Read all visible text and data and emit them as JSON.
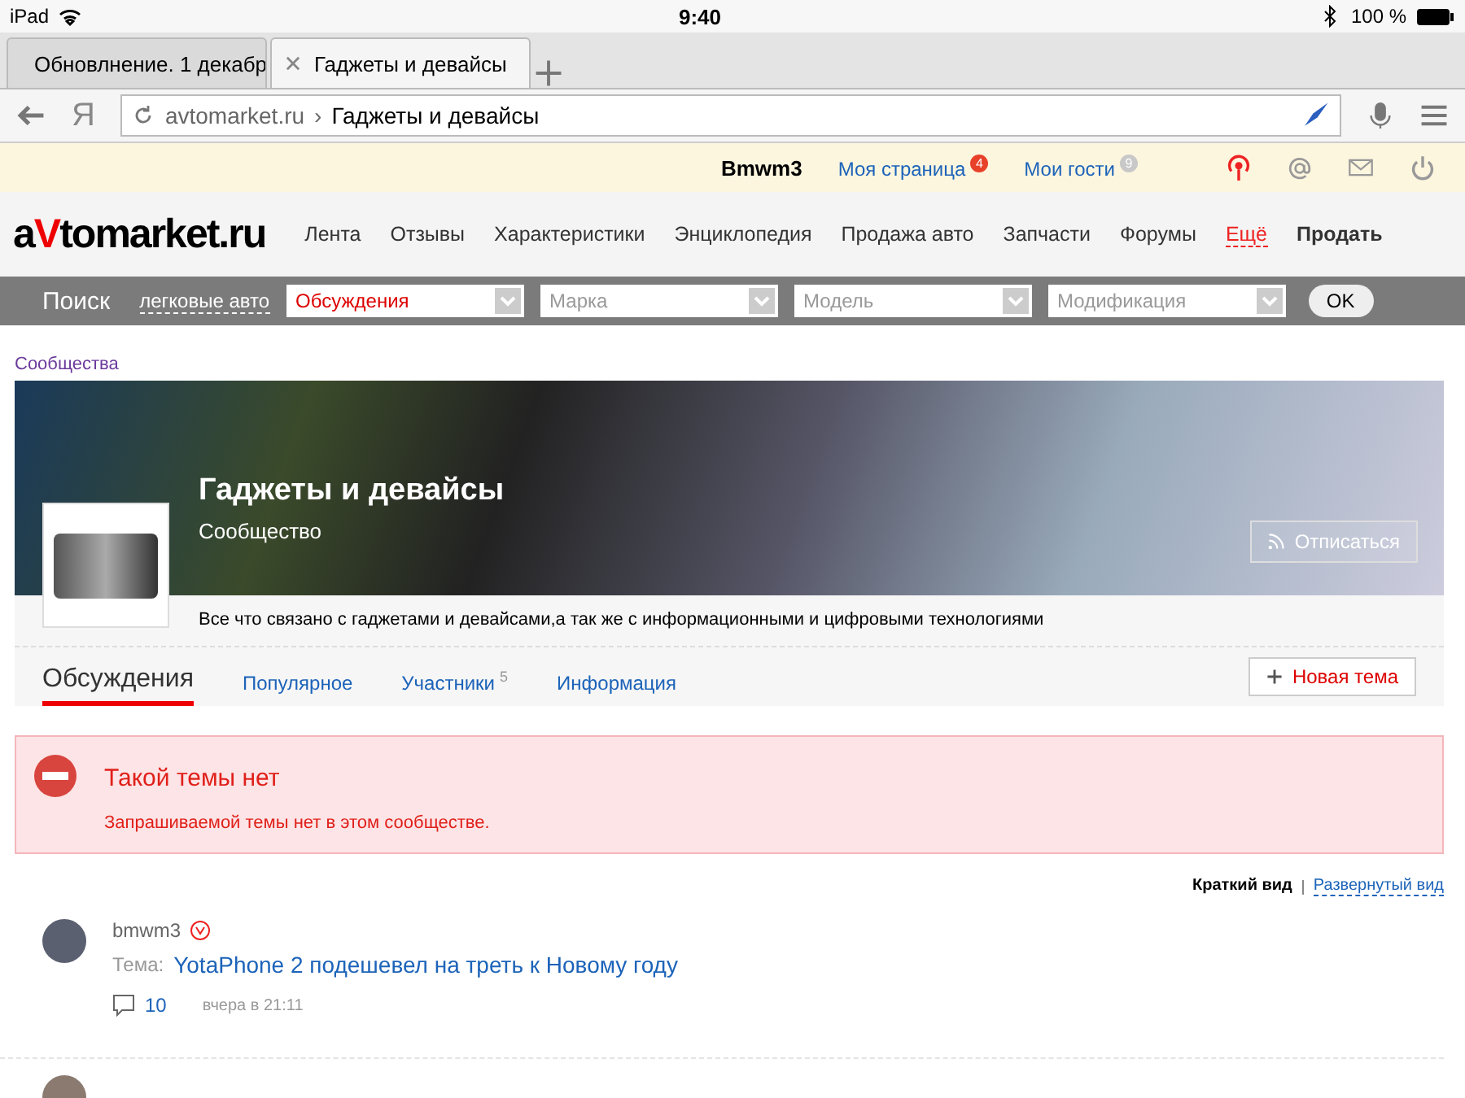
{
  "status_bar": {
    "device": "iPad",
    "time": "9:40",
    "battery": "100 %"
  },
  "browser_tabs": [
    {
      "title": "Обновлнение. 1 декабр",
      "selected": false
    },
    {
      "title": "Гаджеты и девайсы",
      "selected": true
    }
  ],
  "address_bar": {
    "domain": "avtomarket.ru",
    "separator": "›",
    "page": "Гаджеты и девайсы",
    "yandex_mark": "Я"
  },
  "user_bar": {
    "username": "Bmwm3",
    "links": [
      {
        "label": "Моя страница",
        "count": "4",
        "color": "#e8412a"
      },
      {
        "label": "Мои гости",
        "count": "9",
        "color": "#c8c8c8"
      }
    ]
  },
  "site_nav": {
    "logo_a": "a",
    "logo_v": "V",
    "logo_rest": "tomarket.ru",
    "items": [
      {
        "label": "Лента",
        "kind": "link"
      },
      {
        "label": "Отзывы",
        "kind": "link"
      },
      {
        "label": "Характеристики",
        "kind": "link"
      },
      {
        "label": "Энциклопедия",
        "kind": "link"
      },
      {
        "label": "Продажа авто",
        "kind": "link"
      },
      {
        "label": "Запчасти",
        "kind": "link"
      },
      {
        "label": "Форумы",
        "kind": "link"
      },
      {
        "label": "Ещё",
        "kind": "more"
      },
      {
        "label": "Продать",
        "kind": "strong"
      }
    ]
  },
  "search_bar": {
    "title": "Поиск",
    "category": "легковые авто",
    "selects": [
      {
        "value": "Обсуждения"
      },
      {
        "placeholder": "Марка"
      },
      {
        "placeholder": "Модель"
      },
      {
        "placeholder": "Модификация"
      }
    ],
    "button": "OK"
  },
  "breadcrumb": "Сообщества",
  "community": {
    "title": "Гаджеты и девайсы",
    "subtitle": "Сообщество",
    "unsubscribe": "Отписаться",
    "description": "Все что связано с гаджетами и девайсами,а так же с информационными и цифровыми технологиями"
  },
  "community_tabs": [
    {
      "label": "Обсуждения",
      "selected": true
    },
    {
      "label": "Популярное",
      "selected": false
    },
    {
      "label": "Участники",
      "count": "5",
      "selected": false
    },
    {
      "label": "Информация",
      "selected": false
    }
  ],
  "new_topic_button": "Новая тема",
  "error": {
    "title": "Такой темы нет",
    "message": "Запрашиваемой темы нет в этом сообществе."
  },
  "view_toggle": [
    {
      "label": "Краткий вид",
      "selected": true
    },
    {
      "label": "Развернутый вид",
      "selected": false
    }
  ],
  "posts": [
    {
      "author": "bmwm3",
      "topic_label": "Тема:",
      "topic": "YotaPhone 2 подешевел на треть к Новому году",
      "comments": "10",
      "time": "вчера в 21:11"
    }
  ]
}
